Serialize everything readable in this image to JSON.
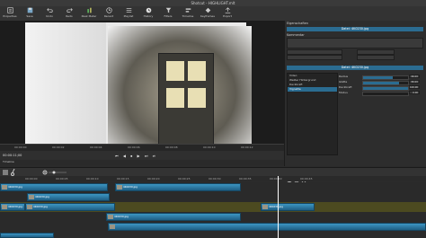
{
  "window": {
    "title": "Shotcut - HIGHLIGHT.mlt"
  },
  "toolbar": {
    "items": [
      {
        "label": "Properties",
        "icon": "properties-icon"
      },
      {
        "label": "Save",
        "icon": "save-icon"
      },
      {
        "label": "Undo",
        "icon": "undo-icon"
      },
      {
        "label": "Redo",
        "icon": "redo-icon"
      },
      {
        "label": "Peak Meter",
        "icon": "meter-icon"
      },
      {
        "label": "Recent",
        "icon": "recent-icon"
      },
      {
        "label": "Playlist",
        "icon": "playlist-icon"
      },
      {
        "label": "History",
        "icon": "history-icon"
      },
      {
        "label": "Filters",
        "icon": "filters-icon"
      },
      {
        "label": "Timeline",
        "icon": "timeline-icon"
      },
      {
        "label": "Keyframes",
        "icon": "keyframes-icon"
      },
      {
        "label": "Export",
        "icon": "export-icon"
      }
    ]
  },
  "viewer": {
    "ruler_ticks": [
      "00:00:00",
      "00:00:02",
      "00:00:04",
      "00:00:06",
      "00:00:08",
      "00:00:10",
      "00:00:12",
      "00:00:14",
      "00:00:16"
    ],
    "timecode": "00:00:11;00",
    "transport_glyphs": "⏮ ◀ ⏹ ▶ ⏭ ⏯",
    "status": "Timeline"
  },
  "properties": {
    "title": "Eigenschaften",
    "file_label": "Datei: 4K0230.jpg",
    "label": "Kommentar"
  },
  "filters": {
    "header": "Datei: 4K0230.jpg",
    "section": "Video",
    "items": [
      {
        "label": "Weißer Hintergrund",
        "selected": false
      },
      {
        "label": "Deckkraft",
        "selected": false
      },
      {
        "label": "Vignette",
        "selected": true
      }
    ],
    "params": [
      {
        "label": "Radius",
        "value": "66.00",
        "fill": 0.66
      },
      {
        "label": "Glätte",
        "value": "80.00",
        "fill": 0.8
      },
      {
        "label": "Deckkraft",
        "value": "100.00",
        "fill": 1.0
      },
      {
        "label": "Modus",
        "value": "0.00",
        "fill": 0.0
      }
    ]
  },
  "timeline": {
    "ruler_ticks": [
      "00:00:00",
      "00:00:05",
      "00:00:10",
      "00:00:15",
      "00:00:20",
      "00:00:25",
      "00:00:30",
      "00:00:35",
      "00:00:40",
      "00:00:45"
    ],
    "tracks": [
      {
        "name": "V3",
        "clips": [
          {
            "label": "4K0230.jpg"
          },
          {
            "label": "4K0230.jpg"
          },
          {
            "label": ""
          }
        ]
      },
      {
        "name": "V2",
        "clips": [
          {
            "label": "4K0230.jpg"
          },
          {
            "label": "4K0230.jpg"
          },
          {
            "label": ""
          }
        ]
      },
      {
        "name": "V1",
        "clips": [
          {
            "label": "4K0230.jpg"
          },
          {
            "label": "4K0230.jpg"
          },
          {
            "label": "4K0230.jpg"
          }
        ]
      }
    ]
  },
  "colors": {
    "accent": "#2b6c91",
    "clip": "#2a82b3",
    "olive": "#4c4a20"
  }
}
